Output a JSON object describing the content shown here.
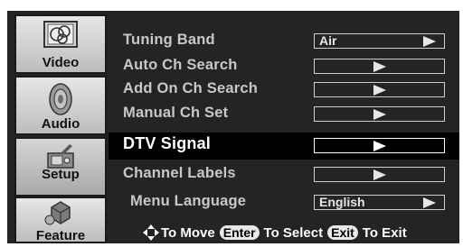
{
  "sidebar": {
    "tabs": [
      {
        "label": "Video",
        "icon": "video-icon"
      },
      {
        "label": "Audio",
        "icon": "speaker-icon"
      },
      {
        "label": "Setup",
        "icon": "setup-icon"
      },
      {
        "label": "Feature",
        "icon": "feature-icon"
      }
    ],
    "active_tab": "Setup"
  },
  "menu": {
    "items": [
      {
        "label": "Tuning Band",
        "value": "Air"
      },
      {
        "label": "Auto Ch Search",
        "value": ""
      },
      {
        "label": "Add On Ch Search",
        "value": ""
      },
      {
        "label": "Manual Ch Set",
        "value": ""
      },
      {
        "label": "DTV Signal",
        "value": ""
      },
      {
        "label": "Channel Labels",
        "value": ""
      },
      {
        "label": "Menu Language",
        "value": "English"
      }
    ],
    "selected_item": "DTV Signal"
  },
  "footer": {
    "move_text": "To Move",
    "enter_key": "Enter",
    "select_text": "To Select",
    "exit_key": "Exit",
    "exit_text": "To Exit",
    "move_icon": "four-way-arrow-icon"
  },
  "colors": {
    "panel_bg": "#242424",
    "highlight_bg": "#000000",
    "label_text": "#c8c8c8",
    "selected_text": "#ffffff",
    "tab_bg": "#d0d0d0"
  }
}
